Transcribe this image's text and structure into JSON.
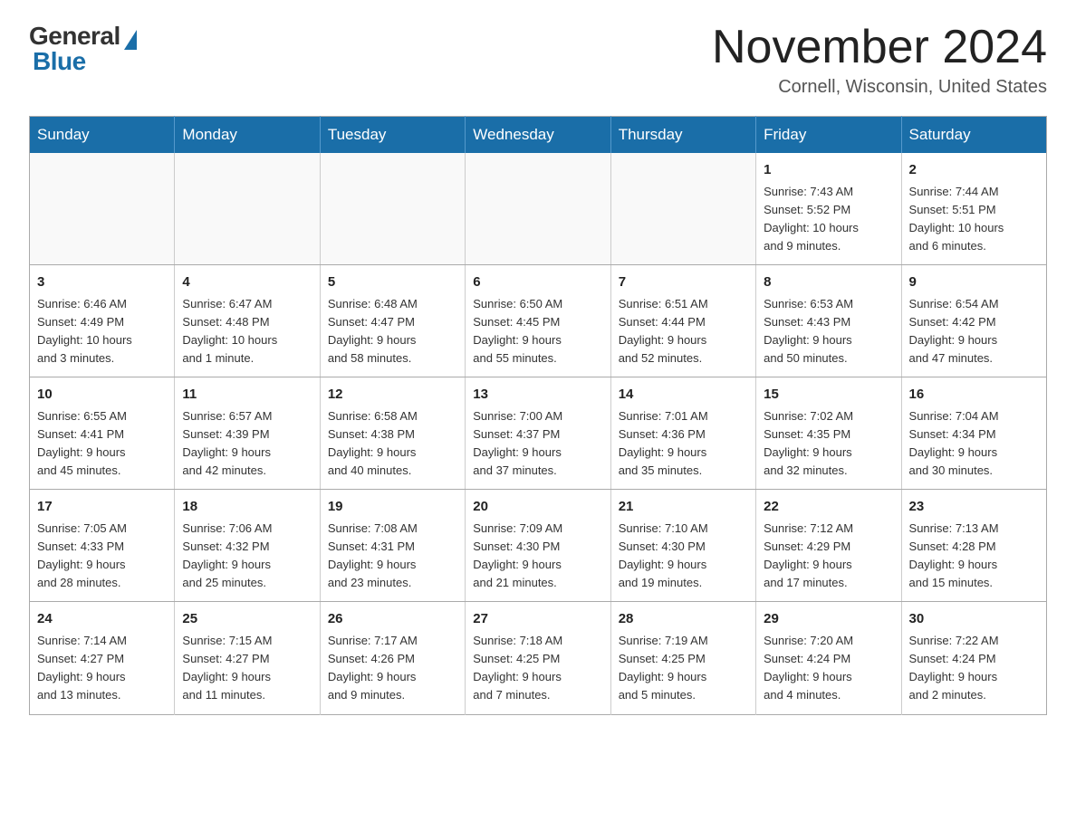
{
  "logo": {
    "general": "General",
    "blue": "Blue"
  },
  "title": "November 2024",
  "location": "Cornell, Wisconsin, United States",
  "weekdays": [
    "Sunday",
    "Monday",
    "Tuesday",
    "Wednesday",
    "Thursday",
    "Friday",
    "Saturday"
  ],
  "weeks": [
    [
      {
        "day": "",
        "info": ""
      },
      {
        "day": "",
        "info": ""
      },
      {
        "day": "",
        "info": ""
      },
      {
        "day": "",
        "info": ""
      },
      {
        "day": "",
        "info": ""
      },
      {
        "day": "1",
        "info": "Sunrise: 7:43 AM\nSunset: 5:52 PM\nDaylight: 10 hours\nand 9 minutes."
      },
      {
        "day": "2",
        "info": "Sunrise: 7:44 AM\nSunset: 5:51 PM\nDaylight: 10 hours\nand 6 minutes."
      }
    ],
    [
      {
        "day": "3",
        "info": "Sunrise: 6:46 AM\nSunset: 4:49 PM\nDaylight: 10 hours\nand 3 minutes."
      },
      {
        "day": "4",
        "info": "Sunrise: 6:47 AM\nSunset: 4:48 PM\nDaylight: 10 hours\nand 1 minute."
      },
      {
        "day": "5",
        "info": "Sunrise: 6:48 AM\nSunset: 4:47 PM\nDaylight: 9 hours\nand 58 minutes."
      },
      {
        "day": "6",
        "info": "Sunrise: 6:50 AM\nSunset: 4:45 PM\nDaylight: 9 hours\nand 55 minutes."
      },
      {
        "day": "7",
        "info": "Sunrise: 6:51 AM\nSunset: 4:44 PM\nDaylight: 9 hours\nand 52 minutes."
      },
      {
        "day": "8",
        "info": "Sunrise: 6:53 AM\nSunset: 4:43 PM\nDaylight: 9 hours\nand 50 minutes."
      },
      {
        "day": "9",
        "info": "Sunrise: 6:54 AM\nSunset: 4:42 PM\nDaylight: 9 hours\nand 47 minutes."
      }
    ],
    [
      {
        "day": "10",
        "info": "Sunrise: 6:55 AM\nSunset: 4:41 PM\nDaylight: 9 hours\nand 45 minutes."
      },
      {
        "day": "11",
        "info": "Sunrise: 6:57 AM\nSunset: 4:39 PM\nDaylight: 9 hours\nand 42 minutes."
      },
      {
        "day": "12",
        "info": "Sunrise: 6:58 AM\nSunset: 4:38 PM\nDaylight: 9 hours\nand 40 minutes."
      },
      {
        "day": "13",
        "info": "Sunrise: 7:00 AM\nSunset: 4:37 PM\nDaylight: 9 hours\nand 37 minutes."
      },
      {
        "day": "14",
        "info": "Sunrise: 7:01 AM\nSunset: 4:36 PM\nDaylight: 9 hours\nand 35 minutes."
      },
      {
        "day": "15",
        "info": "Sunrise: 7:02 AM\nSunset: 4:35 PM\nDaylight: 9 hours\nand 32 minutes."
      },
      {
        "day": "16",
        "info": "Sunrise: 7:04 AM\nSunset: 4:34 PM\nDaylight: 9 hours\nand 30 minutes."
      }
    ],
    [
      {
        "day": "17",
        "info": "Sunrise: 7:05 AM\nSunset: 4:33 PM\nDaylight: 9 hours\nand 28 minutes."
      },
      {
        "day": "18",
        "info": "Sunrise: 7:06 AM\nSunset: 4:32 PM\nDaylight: 9 hours\nand 25 minutes."
      },
      {
        "day": "19",
        "info": "Sunrise: 7:08 AM\nSunset: 4:31 PM\nDaylight: 9 hours\nand 23 minutes."
      },
      {
        "day": "20",
        "info": "Sunrise: 7:09 AM\nSunset: 4:30 PM\nDaylight: 9 hours\nand 21 minutes."
      },
      {
        "day": "21",
        "info": "Sunrise: 7:10 AM\nSunset: 4:30 PM\nDaylight: 9 hours\nand 19 minutes."
      },
      {
        "day": "22",
        "info": "Sunrise: 7:12 AM\nSunset: 4:29 PM\nDaylight: 9 hours\nand 17 minutes."
      },
      {
        "day": "23",
        "info": "Sunrise: 7:13 AM\nSunset: 4:28 PM\nDaylight: 9 hours\nand 15 minutes."
      }
    ],
    [
      {
        "day": "24",
        "info": "Sunrise: 7:14 AM\nSunset: 4:27 PM\nDaylight: 9 hours\nand 13 minutes."
      },
      {
        "day": "25",
        "info": "Sunrise: 7:15 AM\nSunset: 4:27 PM\nDaylight: 9 hours\nand 11 minutes."
      },
      {
        "day": "26",
        "info": "Sunrise: 7:17 AM\nSunset: 4:26 PM\nDaylight: 9 hours\nand 9 minutes."
      },
      {
        "day": "27",
        "info": "Sunrise: 7:18 AM\nSunset: 4:25 PM\nDaylight: 9 hours\nand 7 minutes."
      },
      {
        "day": "28",
        "info": "Sunrise: 7:19 AM\nSunset: 4:25 PM\nDaylight: 9 hours\nand 5 minutes."
      },
      {
        "day": "29",
        "info": "Sunrise: 7:20 AM\nSunset: 4:24 PM\nDaylight: 9 hours\nand 4 minutes."
      },
      {
        "day": "30",
        "info": "Sunrise: 7:22 AM\nSunset: 4:24 PM\nDaylight: 9 hours\nand 2 minutes."
      }
    ]
  ]
}
